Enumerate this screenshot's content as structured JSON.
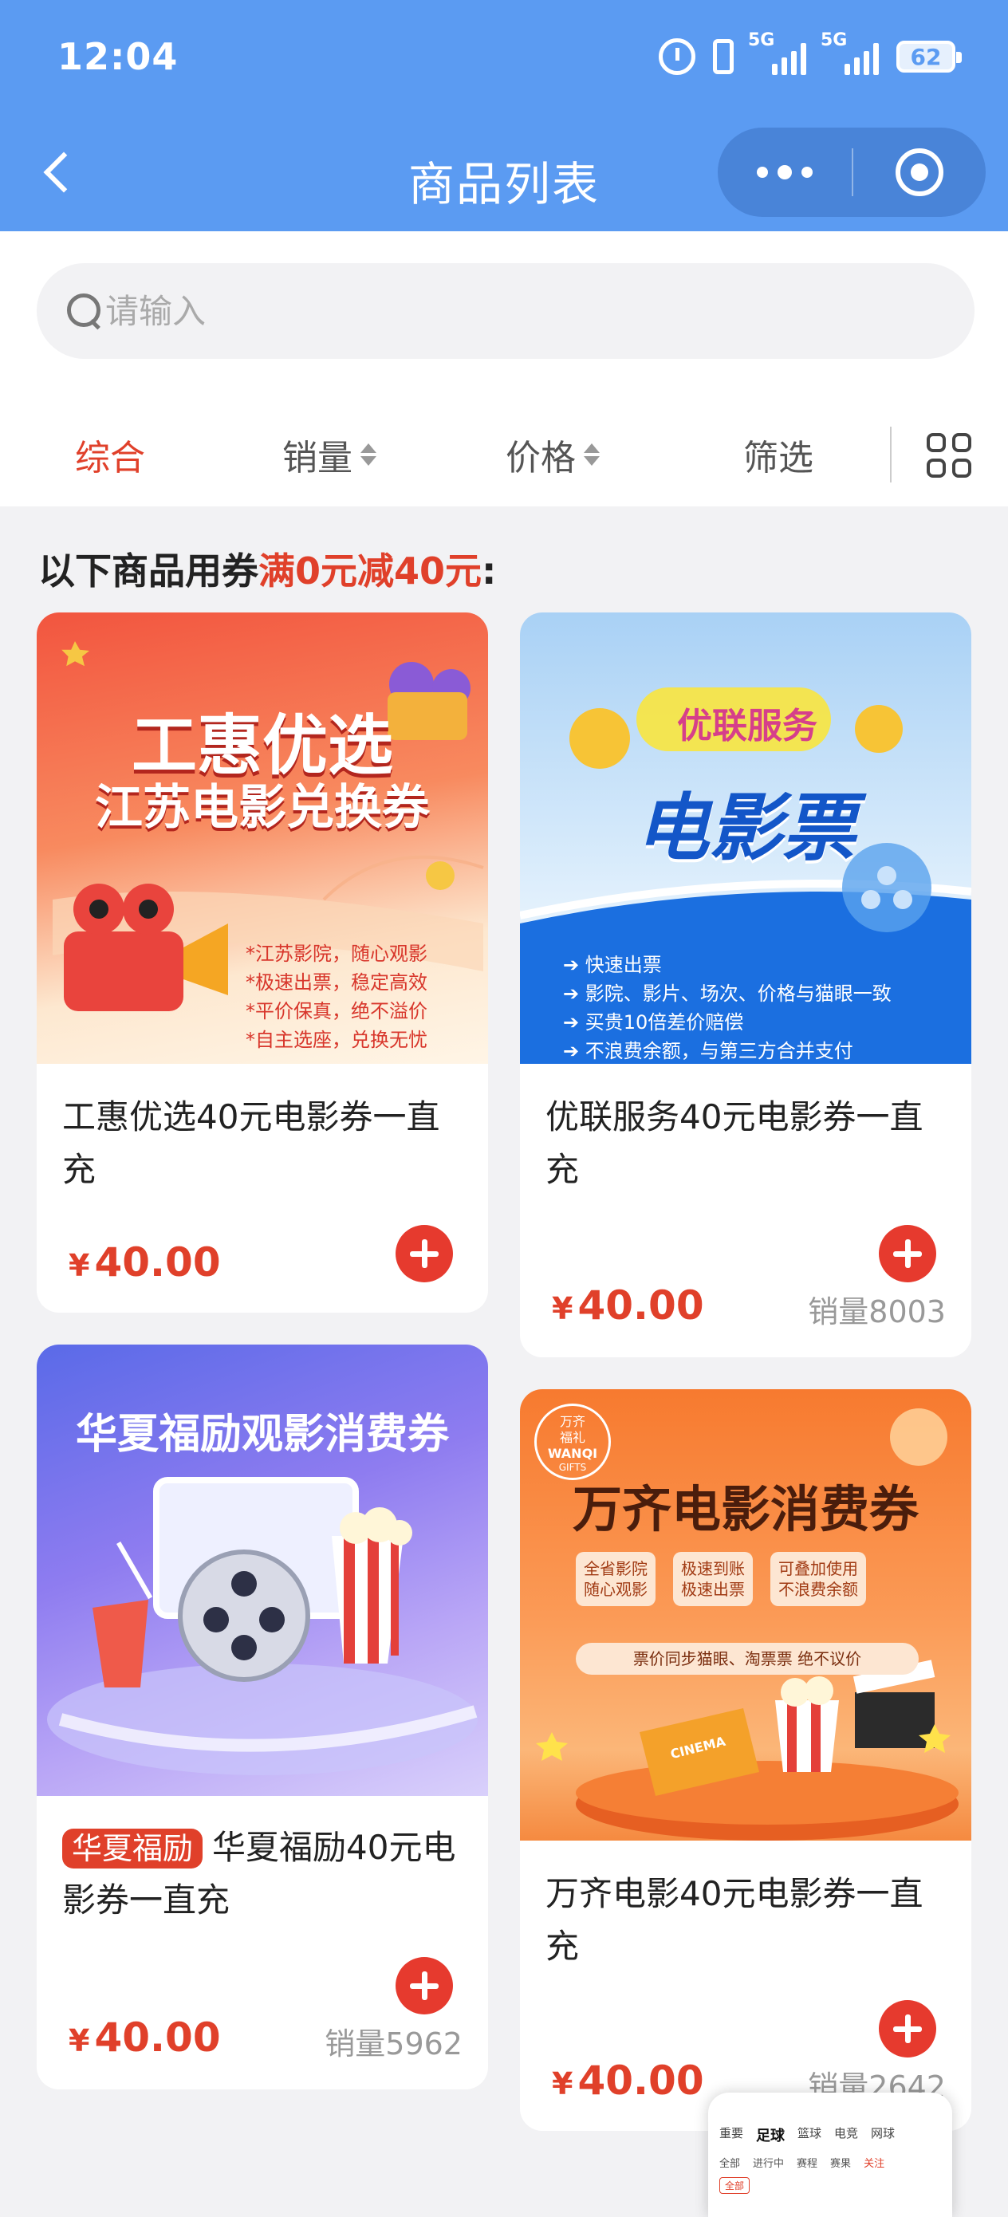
{
  "status_bar": {
    "time": "12:04",
    "network1": "5G",
    "network2": "5G",
    "battery": "62"
  },
  "navbar": {
    "title": "商品列表"
  },
  "search": {
    "placeholder": "请输入"
  },
  "sort": {
    "comprehensive": "综合",
    "sales": "销量",
    "price": "价格",
    "filter": "筛选"
  },
  "coupon": {
    "prefix": "以下商品用券",
    "highlight": "满0元减40元",
    "suffix": ":"
  },
  "products": [
    {
      "name": "工惠优选40元电影券一直充",
      "price": "40.00",
      "currency": "¥",
      "sales": "",
      "art": {
        "line1": "工惠优选",
        "line2": "江苏电影兑换券",
        "features": [
          "*江苏影院，随心观影",
          "*极速出票，稳定高效",
          "*平价保真，绝不溢价",
          "*自主选座，兑换无忧"
        ]
      }
    },
    {
      "name": "优联服务40元电影券一直充",
      "price": "40.00",
      "currency": "¥",
      "sales": "销量8003",
      "art": {
        "bubble": "优联服务",
        "headline": "电影票",
        "features": [
          "快速出票",
          "影院、影片、场次、价格与猫眼一致",
          "买贵10倍差价赔偿",
          "不浪费余额，与第三方合并支付"
        ]
      }
    },
    {
      "badge": "华夏福励",
      "name": "华夏福励40元电影券一直充",
      "price": "40.00",
      "currency": "¥",
      "sales": "销量5962",
      "art": {
        "headline": "华夏福励观影消费券"
      }
    },
    {
      "name": "万齐电影40元电影券一直充",
      "price": "40.00",
      "currency": "¥",
      "sales": "销量2642",
      "art": {
        "logo": [
          "万齐",
          "福礼",
          "WANQI",
          "GIFTS"
        ],
        "headline": "万齐电影消费券",
        "tags": [
          [
            "全省影院",
            "随心观影"
          ],
          [
            "极速到账",
            "极速出票"
          ],
          [
            "可叠加使用",
            "不浪费余额"
          ]
        ],
        "note": "票价同步猫眼、淘票票 绝不议价",
        "ticket": "CINEMA"
      }
    }
  ],
  "mini_window": {
    "tabs": [
      "重要",
      "足球",
      "篮球",
      "电竞",
      "网球"
    ],
    "subtabs": [
      "全部",
      "进行中",
      "赛程",
      "赛果",
      "关注"
    ],
    "chip": "全部"
  }
}
